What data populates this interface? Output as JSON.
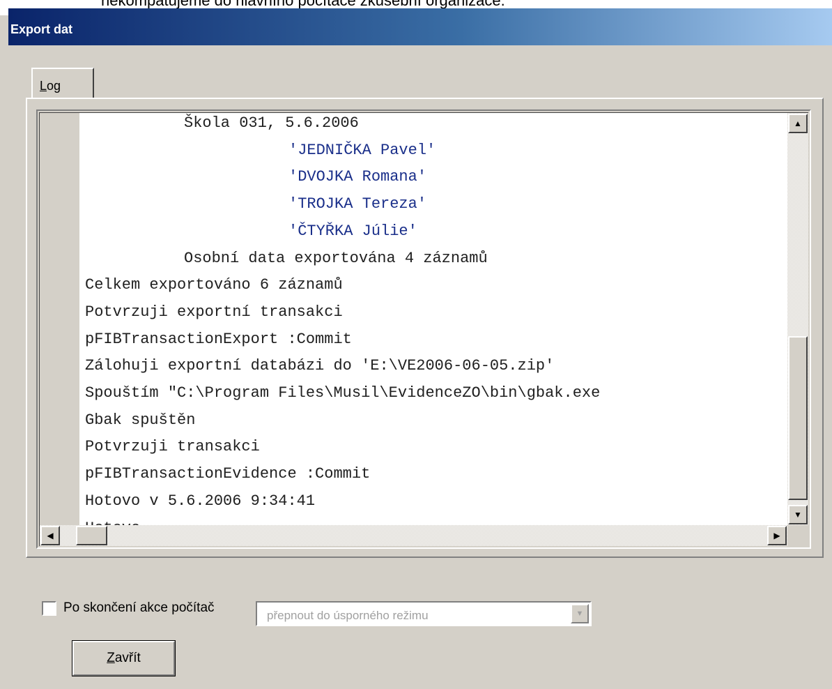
{
  "background_text": "nekompatujeme do hlavního počítače zkušební organizace.",
  "window": {
    "title": "Export dat"
  },
  "tabs": [
    {
      "label": "Log",
      "accel": "L"
    }
  ],
  "log": {
    "lines": [
      {
        "text": "Škola 031, 5.6.2006",
        "indent": 1,
        "string": false
      },
      {
        "text": "'JEDNIČKA Pavel'",
        "indent": 2,
        "string": true
      },
      {
        "text": "'DVOJKA  Romana'",
        "indent": 2,
        "string": true
      },
      {
        "text": "'TROJKA Tereza'",
        "indent": 2,
        "string": true
      },
      {
        "text": "'ČTYŘKA Júlie'",
        "indent": 2,
        "string": true
      },
      {
        "text": "Osobní data exportována 4 záznamů",
        "indent": 1,
        "string": false
      },
      {
        "text": "Celkem exportováno 6 záznamů",
        "indent": 0,
        "string": false
      },
      {
        "text": "Potvrzuji exportní transakci",
        "indent": 0,
        "string": false
      },
      {
        "text": "pFIBTransactionExport :Commit",
        "indent": 0,
        "string": false
      },
      {
        "text": "Zálohuji exportní databázi do 'E:\\VE2006-06-05.zip'",
        "indent": 0,
        "string": false
      },
      {
        "text": "Spouštím \"C:\\Program Files\\Musil\\EvidenceZO\\bin\\gbak.exe",
        "indent": 0,
        "string": false
      },
      {
        "text": "Gbak spuštěn",
        "indent": 0,
        "string": false
      },
      {
        "text": "Potvrzuji transakci",
        "indent": 0,
        "string": false
      },
      {
        "text": "pFIBTransactionEvidence :Commit",
        "indent": 0,
        "string": false
      },
      {
        "text": "Hotovo v 5.6.2006 9:34:41",
        "indent": 0,
        "string": false
      },
      {
        "text": "Hotovo",
        "indent": 0,
        "string": false
      }
    ]
  },
  "options": {
    "checkbox_label": "Po skončení akce počítač",
    "checkbox_checked": false,
    "action_select_value": "přepnout do úsporného režimu",
    "action_select_enabled": false
  },
  "buttons": {
    "close_label": "Zavřít",
    "close_accel": "Z"
  }
}
